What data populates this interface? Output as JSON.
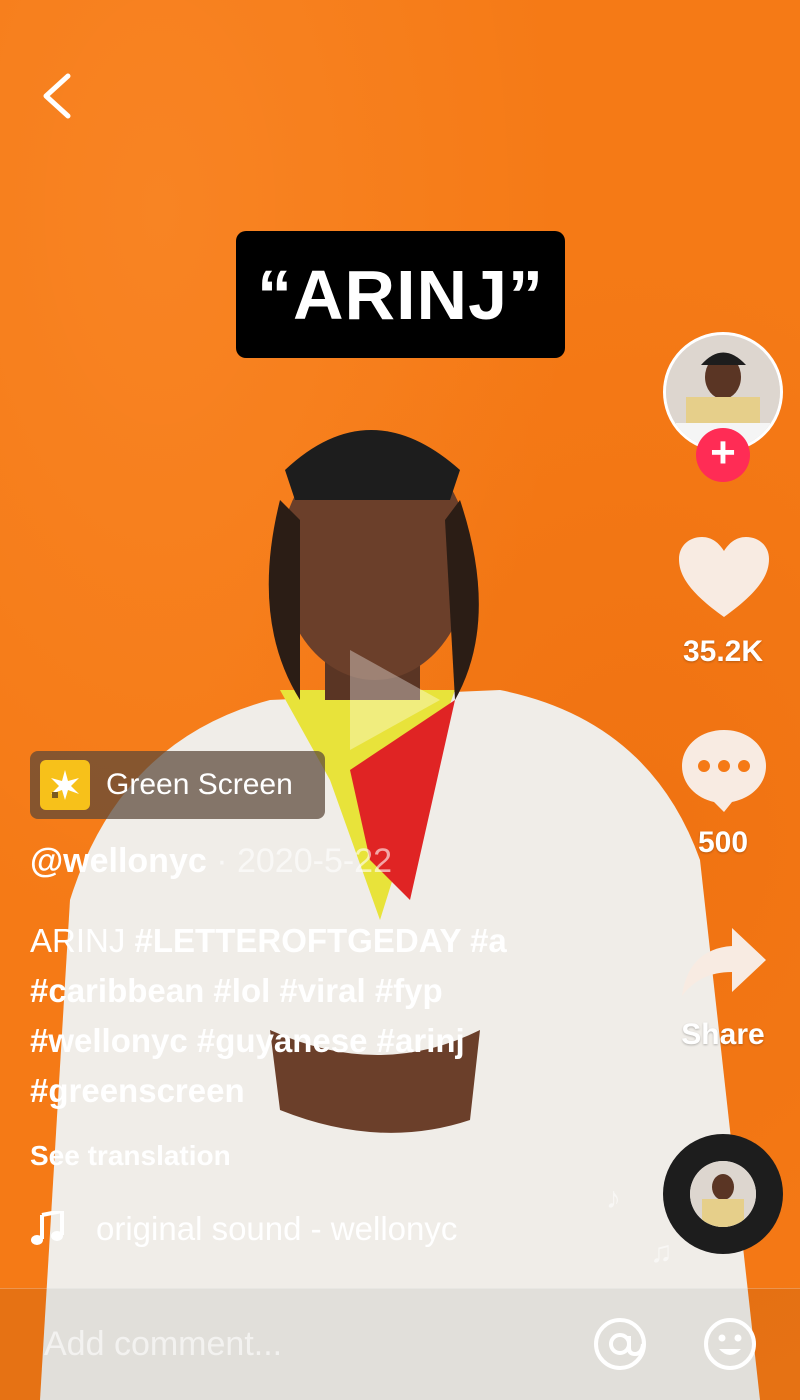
{
  "caption": "“ARINJ”",
  "actions": {
    "like_count": "35.2K",
    "comment_count": "500",
    "share_label": "Share"
  },
  "effect": {
    "label": "Green Screen"
  },
  "post": {
    "handle": "@wellonyc",
    "date": " · 2020-5-22",
    "description_prefix": "ARINJ ",
    "hashtags": "#LETTEROFTGEDAY #a #caribbean #lol #viral #fyp #wellonyc #guyanese #arinj #greenscreen",
    "see_translation": "See translation"
  },
  "sound": {
    "label": "original sound - wellonyc"
  },
  "comment": {
    "placeholder": "Add comment..."
  },
  "colors": {
    "background": "#f57a16",
    "follow": "#ff2c55",
    "effect_icon": "#f7c11a"
  },
  "icons": [
    "back-icon",
    "follow-plus-icon",
    "heart-icon",
    "comment-icon",
    "share-icon",
    "sparkle-icon",
    "music-note-icon",
    "at-icon",
    "emoji-icon"
  ]
}
